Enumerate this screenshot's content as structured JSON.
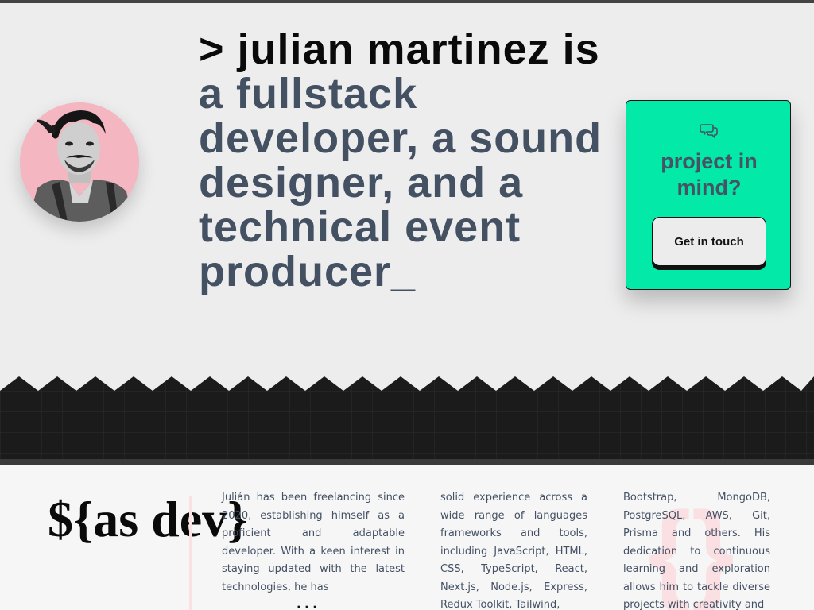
{
  "hero": {
    "headline_dark": "> julian martinez is",
    "headline_rest": " a fullstack developer, a sound designer, and a technical event producer_"
  },
  "cta": {
    "icon": "chat-bubbles-icon",
    "title": "project in mind?",
    "button_label": "Get in touch"
  },
  "about": {
    "heading": "${as dev}",
    "col1": "Julián has been freelancing since 2020, establishing himself as a proficient and adaptable developer. With a keen interest in staying updated with the latest technologies, he has",
    "col2": "solid experience across a wide range of languages frameworks and tools, including JavaScript, HTML, CSS, TypeScript, React, Next.js, Node.js, Express, Redux Toolkit, Tailwind,",
    "col3": "Bootstrap, MongoDB, PostgreSQL, AWS, Git, Prisma and others. His dedication to continuous learning and exploration allows him to tackle diverse projects with creativity and",
    "more": "..."
  },
  "colors": {
    "background": "#ececed",
    "accent_green": "#03eaa8",
    "text_slate": "#445163",
    "avatar_pink": "#f4b6c0",
    "band_dark": "#1b1b1c"
  }
}
